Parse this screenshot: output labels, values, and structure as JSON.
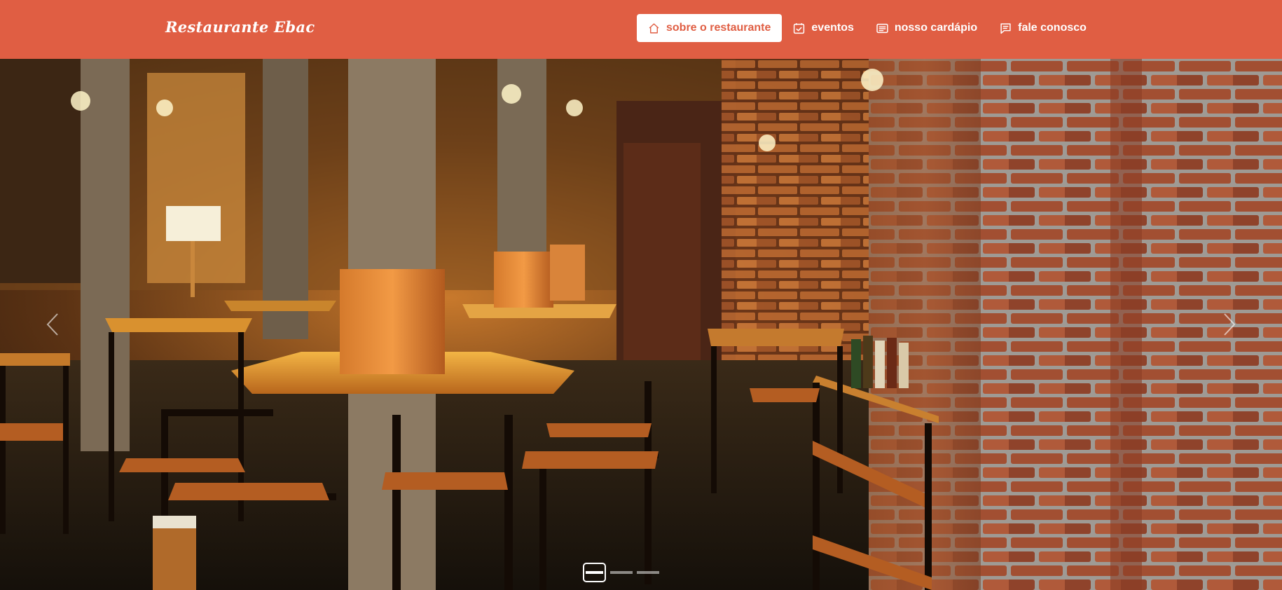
{
  "brand": {
    "name": "Restaurante Ebac"
  },
  "nav": {
    "items": [
      {
        "label": "sobre o restaurante",
        "icon": "house-icon",
        "active": true
      },
      {
        "label": "eventos",
        "icon": "calendar-check-icon",
        "active": false
      },
      {
        "label": "nosso cardápio",
        "icon": "card-text-icon",
        "active": false
      },
      {
        "label": "fale conosco",
        "icon": "chat-text-icon",
        "active": false
      }
    ]
  },
  "carousel": {
    "slide_count": 3,
    "active_slide": 1,
    "image": "restaurant-bar-interior"
  },
  "colors": {
    "brand": "#e05e43",
    "white": "#ffffff"
  }
}
